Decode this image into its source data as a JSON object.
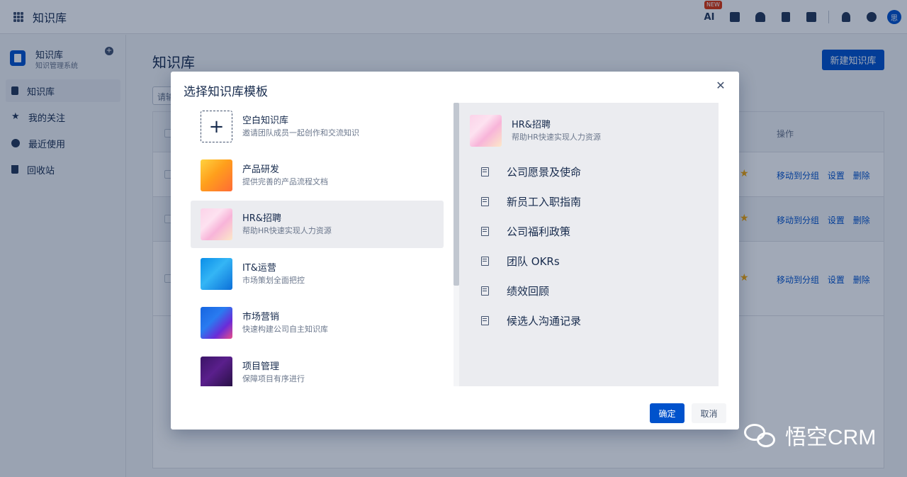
{
  "app": {
    "title": "知识库"
  },
  "topbar": {
    "new_badge": "NEW",
    "ai_label": "AI",
    "avatar_text": "思"
  },
  "sidebar": {
    "title": "知识库",
    "subtitle": "知识管理系统",
    "add_icon": "plus-circle-icon",
    "items": [
      {
        "label": "知识库",
        "icon": "book-icon",
        "active": true
      },
      {
        "label": "我的关注",
        "icon": "star-icon",
        "active": false
      },
      {
        "label": "最近使用",
        "icon": "clock-icon",
        "active": false
      },
      {
        "label": "回收站",
        "icon": "trash-icon",
        "active": false
      }
    ]
  },
  "main": {
    "title": "知识库",
    "new_button": "新建知识库",
    "search_placeholder": "请输",
    "table": {
      "ops_header": "操作",
      "row_actions": [
        "移动到分组",
        "设置",
        "删除"
      ]
    }
  },
  "modal": {
    "title": "选择知识库模板",
    "templates": [
      {
        "name": "空白知识库",
        "desc": "邀请团队成员一起创作和交流知识",
        "thumb": "plus-icon"
      },
      {
        "name": "产品研发",
        "desc": "提供完善的产品流程文档",
        "thumb": "product-thumbnail"
      },
      {
        "name": "HR&招聘",
        "desc": "帮助HR快速实现人力资源",
        "thumb": "hr-thumbnail",
        "selected": true
      },
      {
        "name": "IT&运营",
        "desc": "市场策划全面把控",
        "thumb": "it-thumbnail"
      },
      {
        "name": "市场营销",
        "desc": "快速构建公司自主知识库",
        "thumb": "marketing-thumbnail"
      },
      {
        "name": "项目管理",
        "desc": "保障项目有序进行",
        "thumb": "project-thumbnail"
      }
    ],
    "preview": {
      "name": "HR&招聘",
      "desc": "帮助HR快速实现人力资源",
      "docs": [
        "公司愿景及使命",
        "新员工入职指南",
        "公司福利政策",
        "团队 OKRs",
        "绩效回顾",
        "候选人沟通记录"
      ]
    },
    "confirm_button": "确定",
    "cancel_button": "取消"
  },
  "watermark": {
    "text": "悟空CRM"
  },
  "colors": {
    "primary": "#0052cc",
    "text": "#172b4d",
    "muted": "#6b778c",
    "star": "#ffab00"
  }
}
